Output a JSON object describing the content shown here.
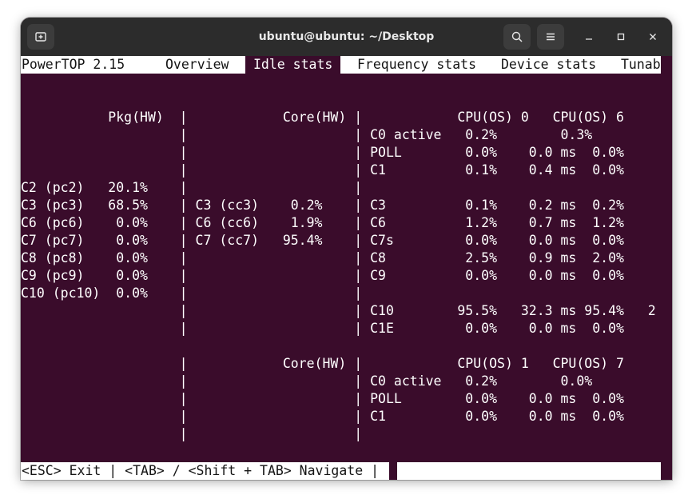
{
  "window": {
    "title": "ubuntu@ubuntu: ~/Desktop"
  },
  "icons": {
    "new_tab": "new-tab-icon",
    "search": "search-icon",
    "menu": "hamburger-menu-icon",
    "minimize": "minimize-icon",
    "maximize": "maximize-icon",
    "close": "close-icon"
  },
  "colors": {
    "terminal_bg": "#3a0c2b",
    "titlebar_bg": "#2c2c2c",
    "header_bar_bg": "#ffffff"
  },
  "header": {
    "app_name": "PowerTOP 2.15",
    "tabs": [
      "Overview",
      "Idle stats",
      "Frequency stats",
      "Device stats",
      "Tunab"
    ],
    "active_tab": "Idle stats"
  },
  "lines": [
    "",
    "",
    "           Pkg(HW)  |            Core(HW) |            CPU(OS) 0   CPU(OS) 6",
    "                    |                     | C0 active   0.2%        0.3%",
    "                    |                     | POLL        0.0%    0.0 ms  0.0%",
    "                    |                     | C1          0.1%    0.4 ms  0.0%",
    "C2 (pc2)   20.1%    |                     |",
    "C3 (pc3)   68.5%    | C3 (cc3)    0.2%    | C3          0.1%    0.2 ms  0.2%",
    "C6 (pc6)    0.0%    | C6 (cc6)    1.9%    | C6          1.2%    0.7 ms  1.2%",
    "C7 (pc7)    0.0%    | C7 (cc7)   95.4%    | C7s         0.0%    0.0 ms  0.0%",
    "C8 (pc8)    0.0%    |                     | C8          2.5%    0.9 ms  2.0%",
    "C9 (pc9)    0.0%    |                     | C9          0.0%    0.0 ms  0.0%",
    "C10 (pc10)  0.0%    |                     |",
    "                    |                     | C10        95.5%   32.3 ms 95.4%   2",
    "                    |                     | C1E         0.0%    0.0 ms  0.0%",
    "",
    "                    |            Core(HW) |            CPU(OS) 1   CPU(OS) 7",
    "                    |                     | C0 active   0.2%        0.0%",
    "                    |                     | POLL        0.0%    0.0 ms  0.0%",
    "                    |                     | C1          0.0%    0.0 ms  0.0%",
    "                    |                     |"
  ],
  "footer": {
    "help": "<ESC> Exit | <TAB> / <Shift + TAB> Navigate |"
  }
}
